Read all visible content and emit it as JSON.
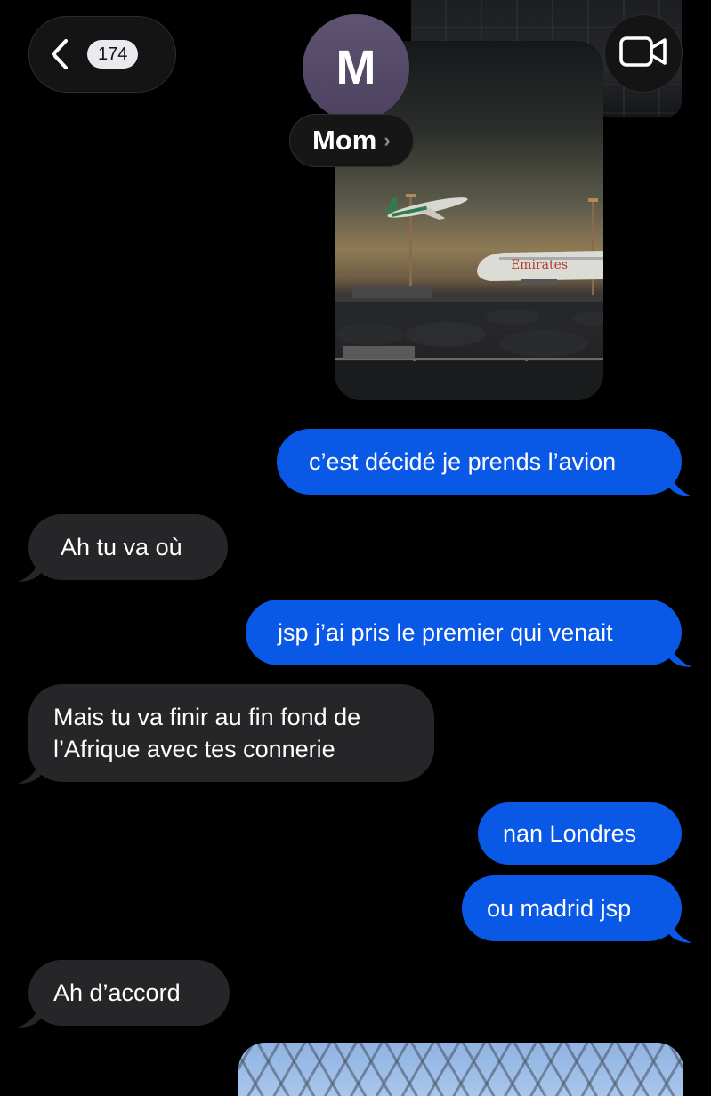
{
  "header": {
    "unread_count": "174",
    "avatar_initial": "M",
    "contact_name": "Mom",
    "chevron": "›"
  },
  "messages": [
    {
      "direction": "sent",
      "text": "c’est décidé je prends l’avion"
    },
    {
      "direction": "received",
      "text": "Ah tu va où"
    },
    {
      "direction": "sent",
      "text": "jsp j’ai pris le premier qui venait"
    },
    {
      "direction": "received",
      "lines": [
        "Mais tu va finir au fin fond de",
        "l’Afrique avec tes connerie"
      ]
    },
    {
      "direction": "sent",
      "text": "nan Londres"
    },
    {
      "direction": "sent",
      "text": "ou madrid jsp"
    },
    {
      "direction": "received",
      "text": "Ah d’accord"
    }
  ],
  "photo": {
    "airline_text": "Emirates"
  },
  "colors": {
    "sent_bubble": "#0a58e6",
    "received_bubble": "#262628",
    "background": "#000000",
    "avatar": "#544a68"
  },
  "icons": {
    "back": "chevron-left-icon",
    "video": "video-camera-icon"
  }
}
